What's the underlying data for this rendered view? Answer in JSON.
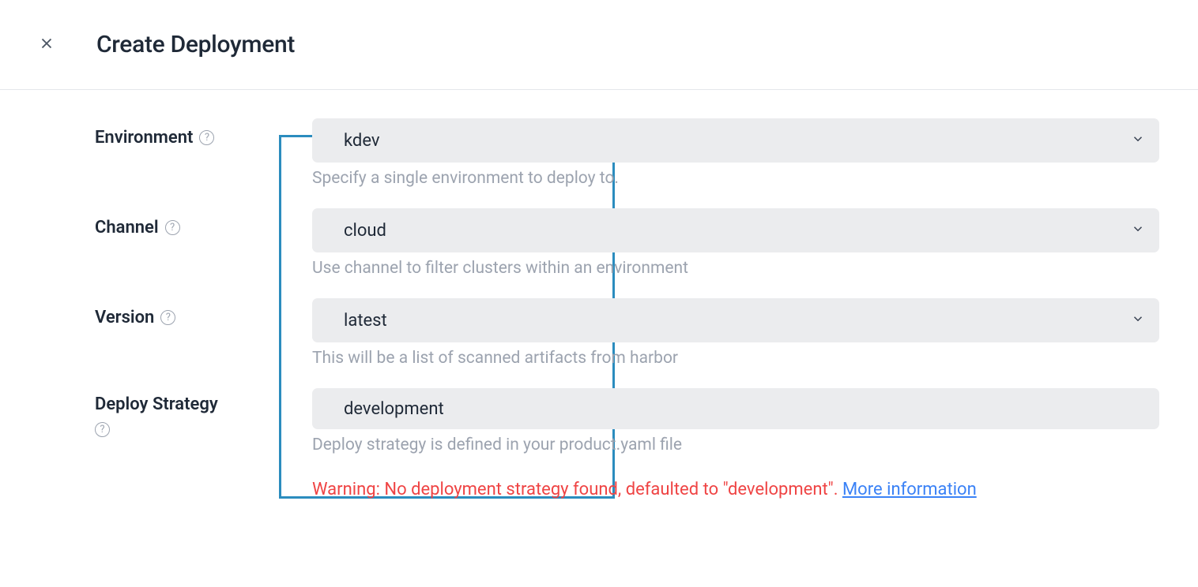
{
  "header": {
    "title": "Create Deployment"
  },
  "form": {
    "environment": {
      "label": "Environment",
      "value": "kdev",
      "help": "Specify a single environment to deploy to."
    },
    "channel": {
      "label": "Channel",
      "value": "cloud",
      "help": "Use channel to filter clusters within an environment"
    },
    "version": {
      "label": "Version",
      "value": "latest",
      "help": "This will be a list of scanned artifacts from harbor"
    },
    "deploy_strategy": {
      "label": "Deploy Strategy",
      "value": "development",
      "help": "Deploy strategy is defined in your product.yaml file"
    }
  },
  "warning": {
    "text": "Warning: No deployment strategy found, defaulted to \"development\". ",
    "link_text": "More information"
  }
}
